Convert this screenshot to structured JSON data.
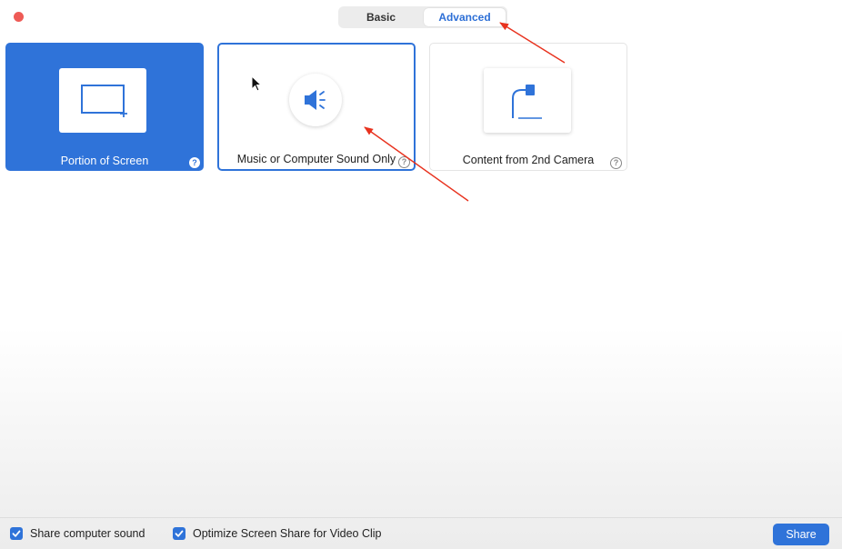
{
  "tabs": {
    "basic_label": "Basic",
    "advanced_label": "Advanced",
    "selected": "Advanced"
  },
  "options": [
    {
      "label": "Portion of Screen",
      "icon": "screen-portion-icon",
      "help": "?"
    },
    {
      "label": "Music or Computer Sound Only",
      "icon": "speaker-icon",
      "help": "?"
    },
    {
      "label": "Content from 2nd Camera",
      "icon": "document-camera-icon",
      "help": "?"
    }
  ],
  "footer": {
    "share_sound_label": "Share computer sound",
    "share_sound_checked": true,
    "optimize_label": "Optimize Screen Share for Video Clip",
    "optimize_checked": true,
    "share_button": "Share"
  },
  "colors": {
    "accent": "#2f73d9",
    "close": "#ee5b56",
    "annotation": "#e8321e"
  }
}
